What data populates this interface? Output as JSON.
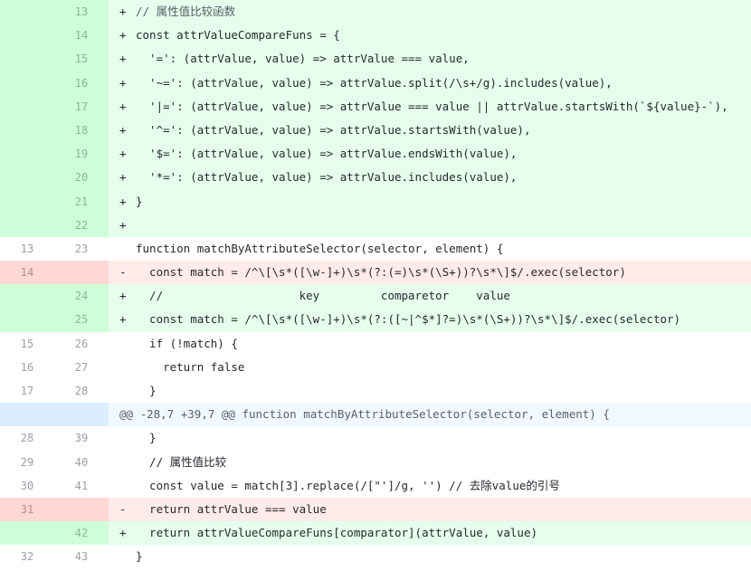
{
  "rows": [
    {
      "type": "add",
      "old": "",
      "new": "13",
      "marker": "+",
      "text": "// 属性值比较函数"
    },
    {
      "type": "add",
      "old": "",
      "new": "14",
      "marker": "+",
      "text": "const attrValueCompareFuns = {"
    },
    {
      "type": "add",
      "old": "",
      "new": "15",
      "marker": "+",
      "text": "  '=': (attrValue, value) => attrValue === value,"
    },
    {
      "type": "add",
      "old": "",
      "new": "16",
      "marker": "+",
      "text": "  '~=': (attrValue, value) => attrValue.split(/\\s+/g).includes(value),"
    },
    {
      "type": "add",
      "old": "",
      "new": "17",
      "marker": "+",
      "text": "  '|=': (attrValue, value) => attrValue === value || attrValue.startsWith(`${value}-`),"
    },
    {
      "type": "add",
      "old": "",
      "new": "18",
      "marker": "+",
      "text": "  '^=': (attrValue, value) => attrValue.startsWith(value),"
    },
    {
      "type": "add",
      "old": "",
      "new": "19",
      "marker": "+",
      "text": "  '$=': (attrValue, value) => attrValue.endsWith(value),"
    },
    {
      "type": "add",
      "old": "",
      "new": "20",
      "marker": "+",
      "text": "  '*=': (attrValue, value) => attrValue.includes(value),"
    },
    {
      "type": "add",
      "old": "",
      "new": "21",
      "marker": "+",
      "text": "}"
    },
    {
      "type": "add",
      "old": "",
      "new": "22",
      "marker": "+",
      "text": ""
    },
    {
      "type": "ctx",
      "old": "13",
      "new": "23",
      "marker": " ",
      "text": "function matchByAttributeSelector(selector, element) {"
    },
    {
      "type": "del",
      "old": "14",
      "new": "",
      "marker": "-",
      "text": "  const match = /^\\[\\s*([\\w-]+)\\s*(?:(=)\\s*(\\S+))?\\s*\\]$/.exec(selector)"
    },
    {
      "type": "add",
      "old": "",
      "new": "24",
      "marker": "+",
      "text": "  //                    key         comparetor    value"
    },
    {
      "type": "add",
      "old": "",
      "new": "25",
      "marker": "+",
      "text": "  const match = /^\\[\\s*([\\w-]+)\\s*(?:([~|^$*]?=)\\s*(\\S+))?\\s*\\]$/.exec(selector)"
    },
    {
      "type": "ctx",
      "old": "15",
      "new": "26",
      "marker": " ",
      "text": "  if (!match) {"
    },
    {
      "type": "ctx",
      "old": "16",
      "new": "27",
      "marker": " ",
      "text": "    return false"
    },
    {
      "type": "ctx",
      "old": "17",
      "new": "28",
      "marker": " ",
      "text": "  }"
    },
    {
      "type": "hunk",
      "old": "",
      "new": "",
      "marker": "",
      "text": "@@ -28,7 +39,7 @@ function matchByAttributeSelector(selector, element) {"
    },
    {
      "type": "ctx",
      "old": "28",
      "new": "39",
      "marker": " ",
      "text": "  }"
    },
    {
      "type": "ctx",
      "old": "29",
      "new": "40",
      "marker": " ",
      "text": "  // 属性值比较"
    },
    {
      "type": "ctx",
      "old": "30",
      "new": "41",
      "marker": " ",
      "text": "  const value = match[3].replace(/[\"']/g, '') // 去除value的引号"
    },
    {
      "type": "del",
      "old": "31",
      "new": "",
      "marker": "-",
      "text": "  return attrValue === value"
    },
    {
      "type": "add",
      "old": "",
      "new": "42",
      "marker": "+",
      "text": "  return attrValueCompareFuns[comparator](attrValue, value)"
    },
    {
      "type": "ctx",
      "old": "32",
      "new": "43",
      "marker": " ",
      "text": "}"
    }
  ],
  "expand_icon": "expand-arrows-icon"
}
